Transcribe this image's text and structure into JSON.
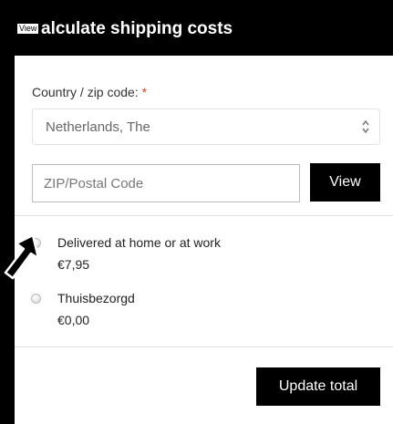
{
  "header": {
    "tag_label": "View",
    "title": "alculate shipping costs"
  },
  "form": {
    "country_label": "Country / zip code:",
    "required_mark": "*",
    "country_value": "Netherlands, The",
    "zip_placeholder": "ZIP/Postal Code",
    "zip_value": "",
    "view_button": "View"
  },
  "options": [
    {
      "name": "Delivered at home or at work",
      "price": "€7,95",
      "selected": false
    },
    {
      "name": "Thuisbezorgd",
      "price": "€0,00",
      "selected": false
    }
  ],
  "actions": {
    "update_button": "Update total"
  },
  "icons": {
    "select_arrows": "up-down-chevron-icon",
    "cursor": "mouse-pointer-icon"
  },
  "colors": {
    "header_bg": "#000000",
    "button_bg": "#000000",
    "required": "#e2401c"
  }
}
